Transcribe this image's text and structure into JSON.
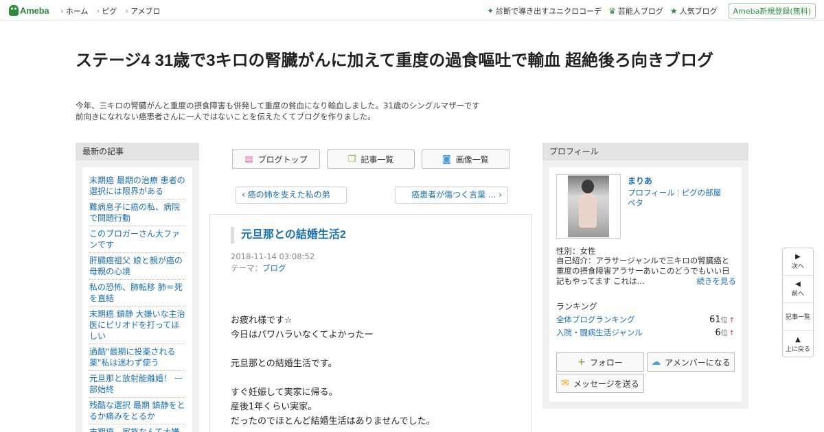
{
  "header": {
    "logo_text": "Ameba",
    "nav": [
      "ホーム",
      "ピグ",
      "アメブロ"
    ],
    "right_links": [
      {
        "label": "診断で導き出すユニクロコーデ",
        "icon": "sparkle-icon"
      },
      {
        "label": "芸能人ブログ",
        "icon": "crown-icon"
      },
      {
        "label": "人気ブログ",
        "icon": "star-icon"
      }
    ],
    "signup_label": "Ameba新規登録(無料)"
  },
  "blog": {
    "title": "ステージ4 31歳で3キロの腎臓がんに加えて重度の過食嘔吐で輸血 超絶後ろ向きブログ",
    "description_lines": [
      "今年、三キロの腎臓がんと重度の摂食障害も併発して重度の貧血になり輸血しました。31歳のシングルマザーです",
      "前向きになれない癌患者さんに一人ではないことを伝えたくてブログを作りました。"
    ]
  },
  "recent": {
    "heading": "最新の記事",
    "items": [
      "末期癌 最期の治療 患者の選択には限界がある",
      "難病息子に癌の私、病院で問題行動",
      "このブロガーさん大ファンです",
      "肝臓癌祖父 娘と親が癌の母親の心境",
      "私の恐怖、肺転移 肺＝死を直結",
      "末期癌 鎮静 大嫌いな主治医にピリオドを打ってほしい",
      "過酷\"最期に投薬される薬\"私は迷わず使う",
      "元旦那と放射能離婚！ 一部始終",
      "残酷な選択 最期 鎮静をとるか痛みをとるか",
      "末期癌、家族なんて大嫌"
    ]
  },
  "nav_buttons": {
    "top": "ブログトップ",
    "list": "記事一覧",
    "images": "画像一覧"
  },
  "pager": {
    "prev": "癌の姉を支えた私の弟",
    "next": "癌患者が傷つく言葉 ..."
  },
  "article": {
    "title": "元旦那との結婚生活2",
    "date": "2018-11-14 03:08:52",
    "theme_label": "テーマ：",
    "theme_link": "ブログ",
    "body_lines": [
      "お疲れ様です☆",
      "今日はパワハラいなくてよかったー",
      "",
      "元旦那との結婚生活です。",
      "",
      "すぐ妊娠して実家に帰る。",
      "産後1年くらい実家。",
      "だったのでほとんど結婚生活はありませんでした。"
    ]
  },
  "profile": {
    "heading": "プロフィール",
    "name": "まりあ",
    "link_profile": "プロフィール",
    "link_room": "ピグの部屋",
    "link_peta": "ペタ",
    "gender": "性別：女性",
    "intro": "自己紹介：アラサージャンルで三キロの腎臓癌と重度の摂食障害アラサーあいこのどうでもいい日記もやってます これは...",
    "more": "続きを見る",
    "ranking_heading": "ランキング",
    "rankings": [
      {
        "label": "全体ブログランキング",
        "rank": "61",
        "unit": "位",
        "trend": "↑"
      },
      {
        "label": "入院・闘病生活ジャンル",
        "rank": "6",
        "unit": "位",
        "trend": "↑"
      }
    ],
    "follow_label": "フォロー",
    "member_label": "アメンバーになる",
    "message_label": "メッセージを送る"
  },
  "sidenav": {
    "next": "次へ",
    "prev": "前へ",
    "list": "記事一覧",
    "top": "上に戻る"
  },
  "colors": {
    "brand": "#2d8c3c",
    "link": "#1a6fb0"
  }
}
